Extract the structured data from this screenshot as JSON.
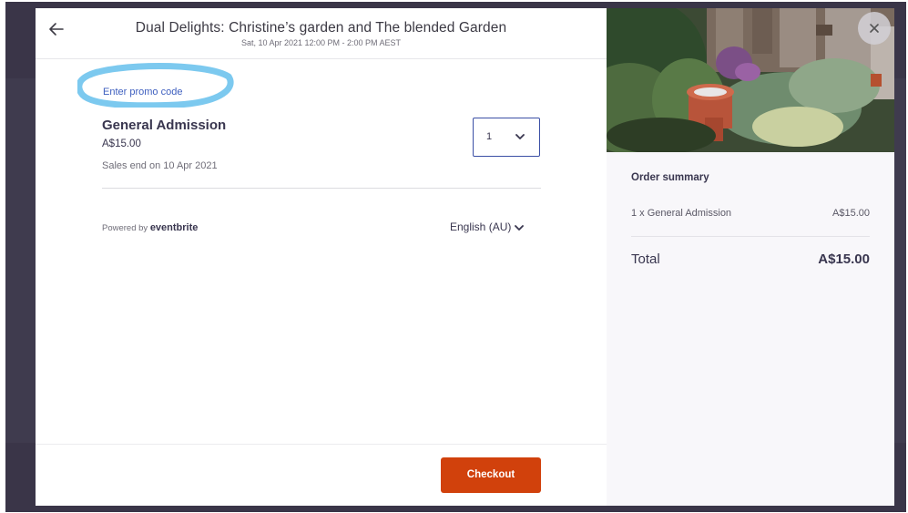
{
  "header": {
    "title": "Dual Delights: Christine’s garden and The blended Garden",
    "date": "Sat, 10 Apr 2021 12:00 PM - 2:00 PM AEST"
  },
  "promo": {
    "label": "Enter promo code",
    "highlight_color": "#7cc9ef"
  },
  "ticket": {
    "name": "General Admission",
    "price": "A$15.00",
    "sales_end": "Sales end on 10 Apr 2021",
    "quantity": "1"
  },
  "footer_info": {
    "powered_by": "Powered by",
    "brand": "eventbrite",
    "language": "English (AU)"
  },
  "checkout": {
    "label": "Checkout",
    "color": "#d1410c"
  },
  "summary": {
    "title": "Order summary",
    "line_item": "1 x General Admission",
    "line_price": "A$15.00",
    "total_label": "Total",
    "total_value": "A$15.00"
  },
  "icons": {
    "back": "arrow-left-icon",
    "close": "close-icon",
    "qty_chevron": "chevron-down-icon",
    "lang_chevron": "chevron-down-icon"
  }
}
